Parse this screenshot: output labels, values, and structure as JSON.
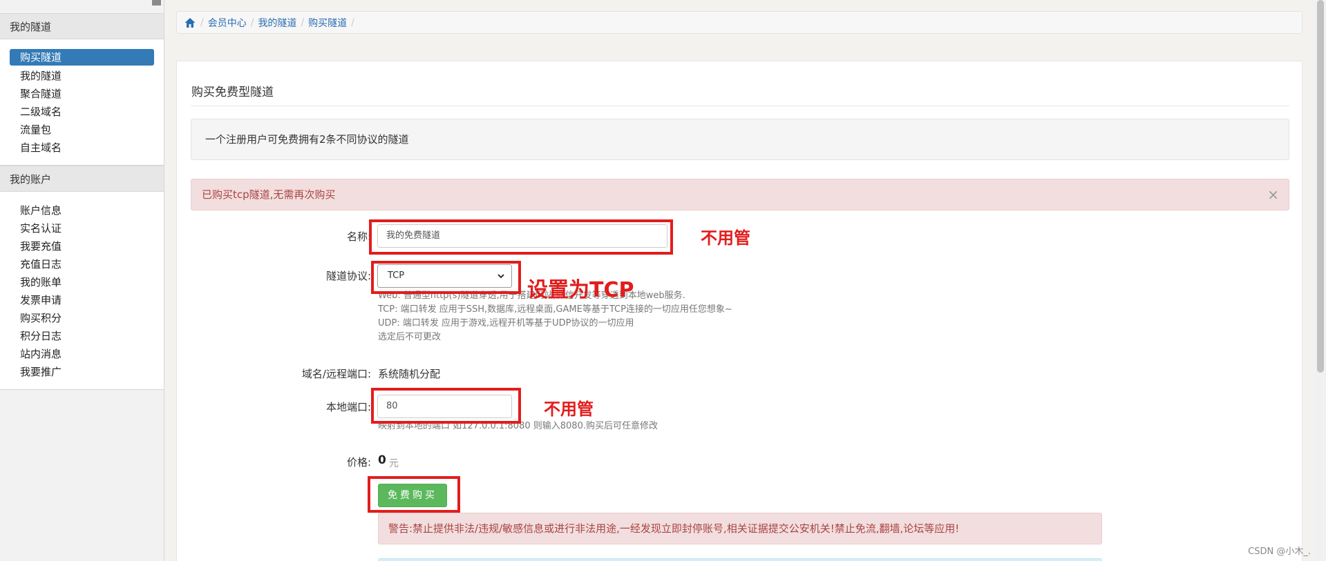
{
  "sidebar": {
    "groups": [
      {
        "title": "我的隧道",
        "items": [
          {
            "label": "购买隧道",
            "active": true
          },
          {
            "label": "我的隧道"
          },
          {
            "label": "聚合隧道"
          },
          {
            "label": "二级域名"
          },
          {
            "label": "流量包"
          },
          {
            "label": "自主域名"
          }
        ]
      },
      {
        "title": "我的账户",
        "items": [
          {
            "label": "账户信息"
          },
          {
            "label": "实名认证"
          },
          {
            "label": "我要充值"
          },
          {
            "label": "充值日志"
          },
          {
            "label": "我的账单"
          },
          {
            "label": "发票申请"
          },
          {
            "label": "购买积分"
          },
          {
            "label": "积分日志"
          },
          {
            "label": "站内消息"
          },
          {
            "label": "我要推广"
          }
        ]
      }
    ]
  },
  "breadcrumb": [
    "会员中心",
    "我的隧道",
    "购买隧道"
  ],
  "main": {
    "title": "购买免费型隧道",
    "info": "一个注册用户可免费拥有2条不同协议的隧道",
    "alert": "已购买tcp隧道,无需再次购买",
    "alert_close": "×",
    "form": {
      "name_label": "名称:",
      "name_value": "我的免费隧道",
      "protocol_label": "隧道协议:",
      "protocol_value": "TCP",
      "protocol_help": [
        "Web: 普通型http(s)隧道穿透,用于搭建网站,微信开发等穿透到本地web服务.",
        "TCP: 端口转发 应用于SSH,数据库,远程桌面,GAME等基于TCP连接的一切应用任您想象~",
        "UDP: 端口转发 应用于游戏,远程开机等基于UDP协议的一切应用",
        "选定后不可更改"
      ],
      "domain_label": "域名/远程端口:",
      "domain_value": "系统随机分配",
      "local_port_label": "本地端口:",
      "local_port_value": "80",
      "local_port_help": "映射到本地的端口 如127.0.0.1:8080 则输入8080.购买后可任意修改",
      "price_label": "价格:",
      "price_value": "0",
      "price_unit": "元",
      "buy_button": "免费购买"
    },
    "warning": "警告:禁止提供非法/违规/敏感信息或进行非法用途,一经发现立即封停账号,相关证据提交公安机关!禁止免流,翻墙,论坛等应用!"
  },
  "annotations": {
    "name_note": "不用管",
    "protocol_note": "设置为TCP",
    "port_note": "不用管",
    "color": "#e31c1c"
  },
  "watermark": "CSDN @小木_."
}
